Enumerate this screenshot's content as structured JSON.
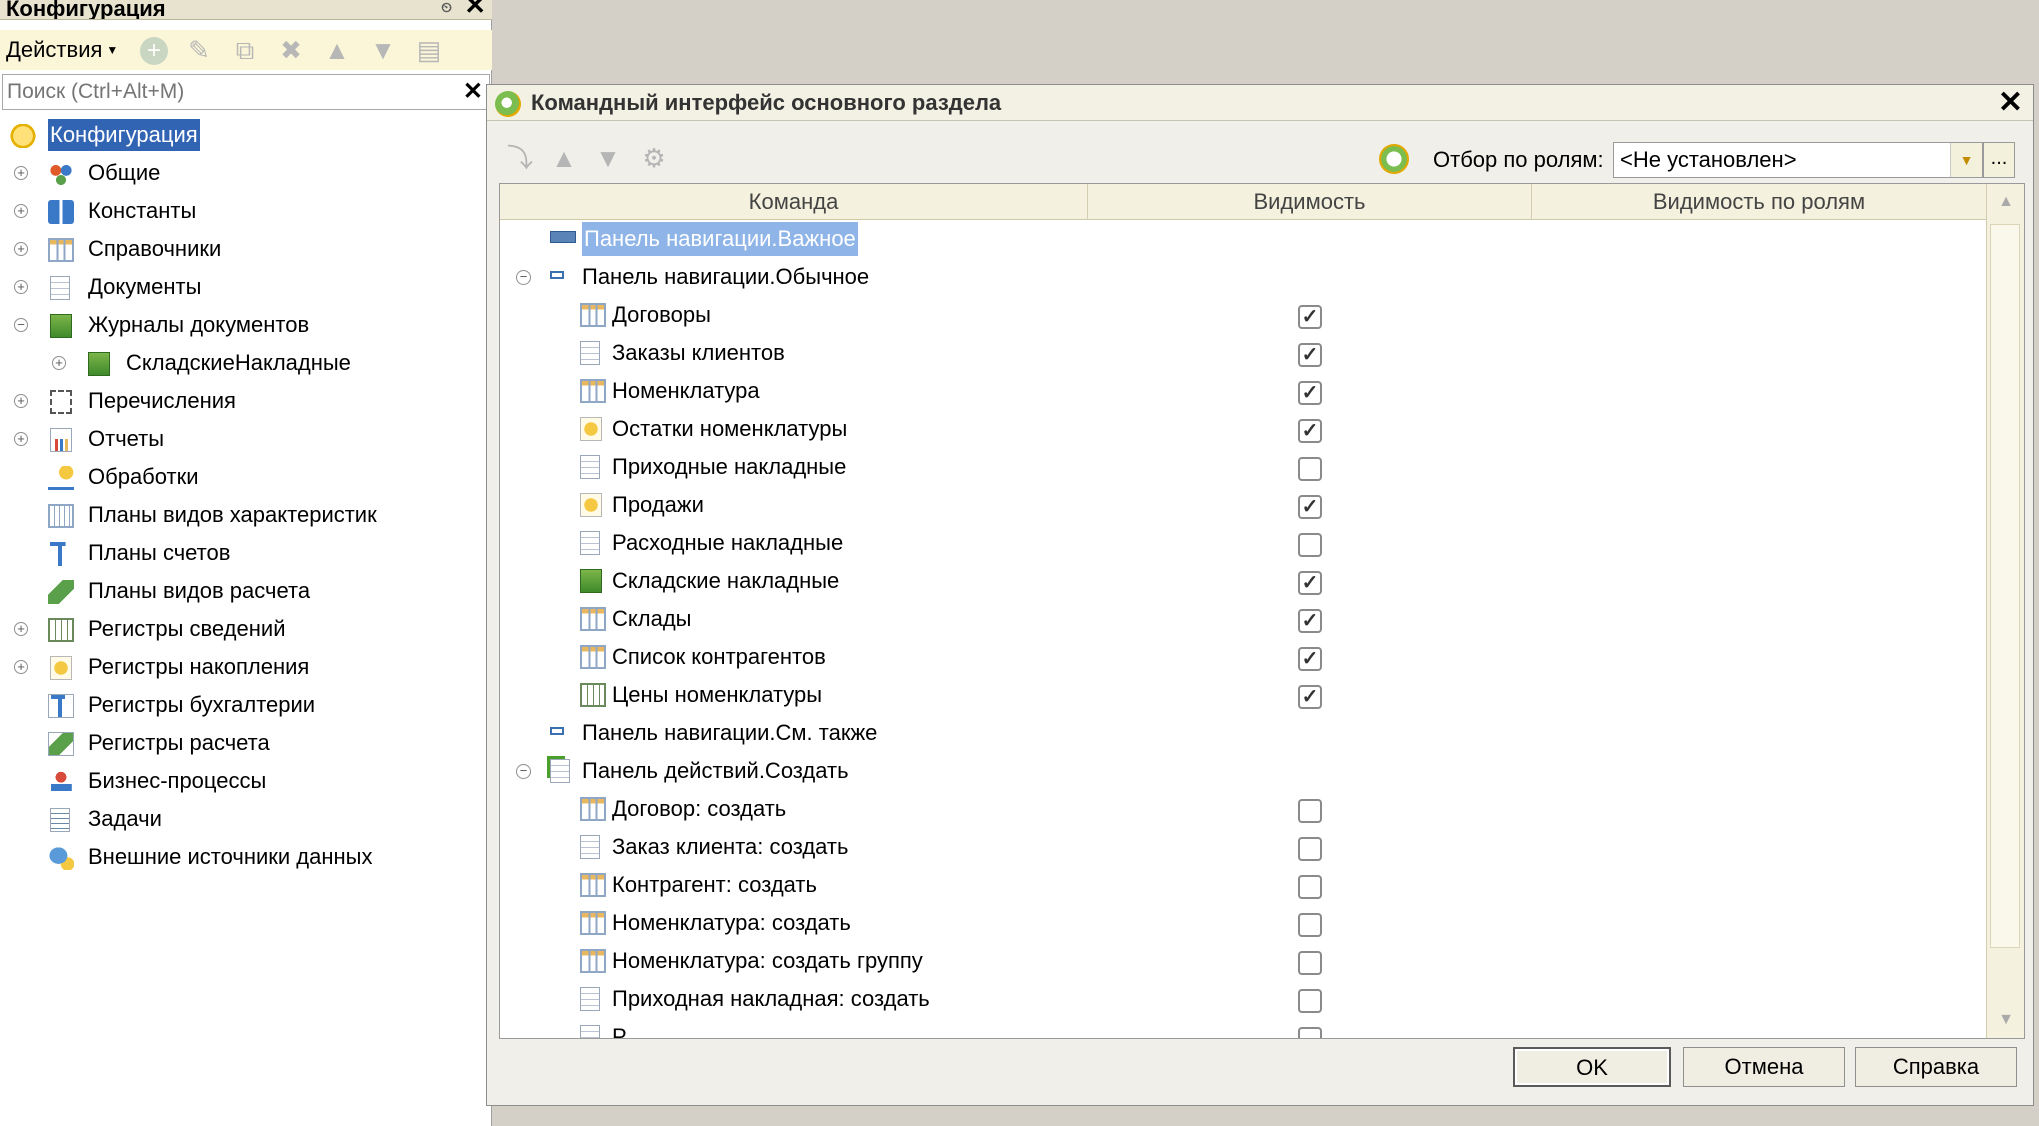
{
  "left_panel": {
    "title": "Конфигурация",
    "actions_label": "Действия",
    "search_placeholder": "Поиск (Ctrl+Alt+M)",
    "tree": [
      {
        "label": "Конфигурация",
        "icon": "config-icon",
        "selected": true
      },
      {
        "label": "Общие",
        "icon": "common-icon"
      },
      {
        "label": "Константы",
        "icon": "constants-icon"
      },
      {
        "label": "Справочники",
        "icon": "catalogs-icon"
      },
      {
        "label": "Документы",
        "icon": "documents-icon"
      },
      {
        "label": "Журналы документов",
        "icon": "journals-icon"
      },
      {
        "label": "СкладскиеНакладные",
        "icon": "journal-item-icon"
      },
      {
        "label": "Перечисления",
        "icon": "enums-icon"
      },
      {
        "label": "Отчеты",
        "icon": "reports-icon"
      },
      {
        "label": "Обработки",
        "icon": "dataprocessors-icon"
      },
      {
        "label": "Планы видов характеристик",
        "icon": "chart-of-characteristic-types-icon"
      },
      {
        "label": "Планы счетов",
        "icon": "chart-of-accounts-icon"
      },
      {
        "label": "Планы видов расчета",
        "icon": "chart-of-calculation-types-icon"
      },
      {
        "label": "Регистры сведений",
        "icon": "information-registers-icon"
      },
      {
        "label": "Регистры накопления",
        "icon": "accumulation-registers-icon"
      },
      {
        "label": "Регистры бухгалтерии",
        "icon": "accounting-registers-icon"
      },
      {
        "label": "Регистры расчета",
        "icon": "calculation-registers-icon"
      },
      {
        "label": "Бизнес-процессы",
        "icon": "business-processes-icon"
      },
      {
        "label": "Задачи",
        "icon": "tasks-icon"
      },
      {
        "label": "Внешние источники данных",
        "icon": "external-data-sources-icon"
      }
    ]
  },
  "dialog": {
    "title": "Командный интерфейс основного раздела",
    "role_filter_label": "Отбор по ролям:",
    "role_filter_value": "<Не установлен>",
    "role_more": "...",
    "columns": [
      "Команда",
      "Видимость",
      "Видимость по ролям"
    ],
    "rows": [
      {
        "label": "Панель навигации.Важное",
        "level": 0,
        "kind": "panel",
        "selected": true
      },
      {
        "label": "Панель навигации.Обычное",
        "level": 0,
        "kind": "group",
        "expanded": true
      },
      {
        "label": "Договоры",
        "level": 1,
        "kind": "table",
        "visible": true
      },
      {
        "label": "Заказы клиентов",
        "level": 1,
        "kind": "doc",
        "visible": true
      },
      {
        "label": "Номенклатура",
        "level": 1,
        "kind": "table",
        "visible": true
      },
      {
        "label": "Остатки номенклатуры",
        "level": 1,
        "kind": "coins",
        "visible": true
      },
      {
        "label": "Приходные накладные",
        "level": 1,
        "kind": "doc",
        "visible": false
      },
      {
        "label": "Продажи",
        "level": 1,
        "kind": "coins",
        "visible": true
      },
      {
        "label": "Расходные накладные",
        "level": 1,
        "kind": "doc",
        "visible": false
      },
      {
        "label": "Складские накладные",
        "level": 1,
        "kind": "green",
        "visible": true
      },
      {
        "label": "Склады",
        "level": 1,
        "kind": "table",
        "visible": true
      },
      {
        "label": "Список контрагентов",
        "level": 1,
        "kind": "table",
        "visible": true
      },
      {
        "label": "Цены номенклатуры",
        "level": 1,
        "kind": "grid",
        "visible": true
      },
      {
        "label": "Панель навигации.См. также",
        "level": 0,
        "kind": "group"
      },
      {
        "label": "Панель действий.Создать",
        "level": 0,
        "kind": "create",
        "expanded": true
      },
      {
        "label": "Договор: создать",
        "level": 1,
        "kind": "table",
        "visible": false
      },
      {
        "label": "Заказ клиента: создать",
        "level": 1,
        "kind": "doc",
        "visible": false
      },
      {
        "label": "Контрагент: создать",
        "level": 1,
        "kind": "table",
        "visible": false
      },
      {
        "label": "Номенклатура: создать",
        "level": 1,
        "kind": "table",
        "visible": false
      },
      {
        "label": "Номенклатура: создать группу",
        "level": 1,
        "kind": "table",
        "visible": false
      },
      {
        "label": "Приходная накладная: создать",
        "level": 1,
        "kind": "doc",
        "visible": false
      },
      {
        "label": "Р",
        "level": 1,
        "kind": "doc",
        "visible": false
      }
    ],
    "buttons": {
      "ok": "OK",
      "cancel": "Отмена",
      "help": "Справка"
    }
  }
}
